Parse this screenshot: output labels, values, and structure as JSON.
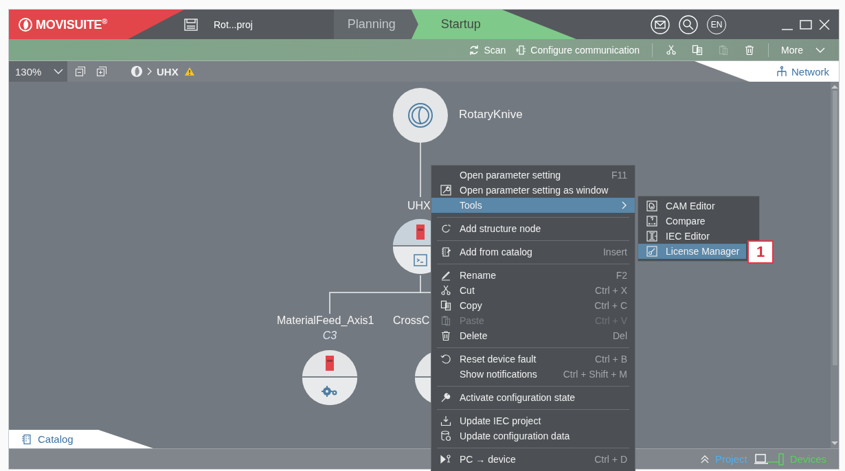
{
  "app": {
    "name": "MOVISUITE$^{®}$",
    "project": "Rot...proj",
    "language": "EN"
  },
  "workflow_tabs": [
    {
      "label": "Planning",
      "selected": false
    },
    {
      "label": "Startup",
      "selected": true
    }
  ],
  "toolbar": {
    "scan": "Scan",
    "configure": "Configure communication",
    "edit_buttons": [
      {
        "disabled": false
      },
      {
        "disabled": false
      },
      {
        "disabled": true
      },
      {
        "disabled": false
      }
    ],
    "more": "More"
  },
  "navigation": {
    "zoom": "130%",
    "breadcrumb": "UHX",
    "warning": true,
    "view_tab": "Network"
  },
  "diagram": {
    "nodes": [
      {
        "kind": "project",
        "label": "RotaryKnive"
      },
      {
        "kind": "inverter",
        "label": "UHX"
      },
      {
        "kind": "axis",
        "label": "MaterialFeed_Axis1",
        "sublabel": "C3"
      },
      {
        "kind": "axis",
        "label": "CrossC"
      }
    ]
  },
  "context_menu": {
    "groups": [
      [
        {
          "label": "Open parameter setting",
          "shortcut": "F11",
          "selected": false,
          "disabled": false,
          "submenu": false
        },
        {
          "label": "Open parameter setting as window",
          "selected": false,
          "disabled": false,
          "submenu": false
        },
        {
          "label": "Tools",
          "selected": true,
          "disabled": false,
          "submenu": true
        }
      ],
      [
        {
          "label": "Add structure node",
          "selected": false,
          "disabled": false,
          "submenu": false
        }
      ],
      [
        {
          "label": "Add from catalog",
          "shortcut": "Insert",
          "selected": false,
          "disabled": false,
          "submenu": false
        }
      ],
      [
        {
          "label": "Rename",
          "shortcut": "F2",
          "selected": false,
          "disabled": false,
          "submenu": false
        },
        {
          "label": "Cut",
          "shortcut": "Ctrl + X",
          "selected": false,
          "disabled": false,
          "submenu": false
        },
        {
          "label": "Copy",
          "shortcut": "Ctrl + C",
          "selected": false,
          "disabled": false,
          "submenu": false
        },
        {
          "label": "Paste",
          "shortcut": "Ctrl + V",
          "selected": false,
          "disabled": true,
          "submenu": false
        },
        {
          "label": "Delete",
          "shortcut": "Del",
          "selected": false,
          "disabled": false,
          "submenu": false
        }
      ],
      [
        {
          "label": "Reset device fault",
          "shortcut": "Ctrl + B",
          "selected": false,
          "disabled": false,
          "submenu": false
        },
        {
          "label": "Show notifications",
          "shortcut": "Ctrl + Shift + M",
          "selected": false,
          "disabled": false,
          "submenu": false
        }
      ],
      [
        {
          "label": "Activate configuration state",
          "selected": false,
          "disabled": false,
          "submenu": false
        }
      ],
      [
        {
          "label": "Update IEC project",
          "selected": false,
          "disabled": false,
          "submenu": false
        },
        {
          "label": "Update configuration data",
          "selected": false,
          "disabled": false,
          "submenu": false
        }
      ],
      [
        {
          "label": "PC → device",
          "shortcut": "Ctrl + D",
          "selected": false,
          "disabled": false,
          "submenu": false
        }
      ]
    ]
  },
  "submenu": {
    "items": [
      {
        "label": "CAM Editor",
        "selected": false
      },
      {
        "label": "Compare",
        "selected": false
      },
      {
        "label": "IEC Editor",
        "selected": false
      },
      {
        "label": "License Manager",
        "selected": true
      }
    ]
  },
  "callout": "1",
  "catalog_tab": "Catalog",
  "status_bar": {
    "project": "Project",
    "devices": "Devices"
  }
}
